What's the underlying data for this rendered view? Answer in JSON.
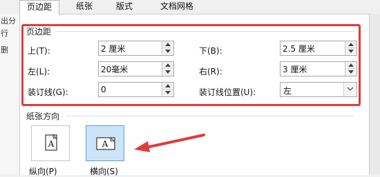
{
  "background_text": [
    "出分",
    "行",
    "删"
  ],
  "tabs": [
    {
      "label": "页边距",
      "active": true
    },
    {
      "label": "纸张",
      "active": false
    },
    {
      "label": "版式",
      "active": false
    },
    {
      "label": "文档网格",
      "active": false
    }
  ],
  "margins": {
    "group_title": "页边距",
    "top": {
      "label": "上(T):",
      "value": "2 厘米"
    },
    "bottom": {
      "label": "下(B):",
      "value": "2.5 厘米"
    },
    "left": {
      "label": "左(L):",
      "value": "20毫米"
    },
    "right": {
      "label": "右(R):",
      "value": "3 厘米"
    },
    "gutter": {
      "label": "装订线(G):",
      "value": "0"
    },
    "gutter_position": {
      "label": "装订线位置(U):",
      "value": "左"
    }
  },
  "orientation": {
    "group_title": "纸张方向",
    "portrait": {
      "label": "纵向(P)",
      "icon_letter": "A",
      "selected": false
    },
    "landscape": {
      "label": "横向(S)",
      "icon_letter": "A",
      "selected": true
    }
  },
  "colors": {
    "highlight_red": "#e03a3a",
    "selected_blue": "#cce4f7"
  }
}
